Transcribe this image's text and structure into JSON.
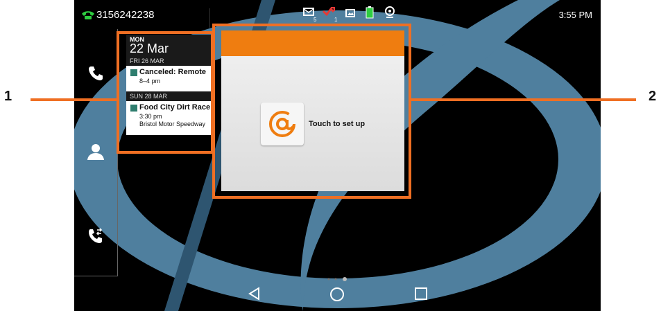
{
  "status_bar": {
    "phone_number": "3156242238",
    "time": "3:55 PM",
    "email_count": "5",
    "missed_call_count": "1",
    "icons": [
      "call-icon",
      "email-notification-icon",
      "missed-call-icon",
      "gallery-icon",
      "battery-icon",
      "webcam-icon"
    ]
  },
  "dock": {
    "items": [
      "phone-icon",
      "contacts-icon",
      "call-transfer-icon"
    ]
  },
  "calendar_widget": {
    "day_of_week": "MON",
    "date": "22 Mar",
    "sections": [
      {
        "header": "FRI 26 MAR",
        "events": [
          {
            "title": "Canceled: Remote",
            "time": "8–4 pm",
            "location": ""
          }
        ]
      },
      {
        "header": "SUN 28 MAR",
        "events": [
          {
            "title": "Food City Dirt Race",
            "time": "3:30 pm",
            "location": "Bristol Motor Speedway"
          }
        ]
      }
    ],
    "event_color": "#2e7d6e"
  },
  "email_widget": {
    "label": "Touch to set up",
    "icon": "at-sign-icon",
    "accent": "#ef7d10"
  },
  "callouts": {
    "left": "1",
    "right": "2",
    "color": "#ef6f23"
  },
  "page_indicator": {
    "pages": 3,
    "current": 3
  },
  "nav_bar": [
    "back-icon",
    "home-icon",
    "recents-icon"
  ]
}
